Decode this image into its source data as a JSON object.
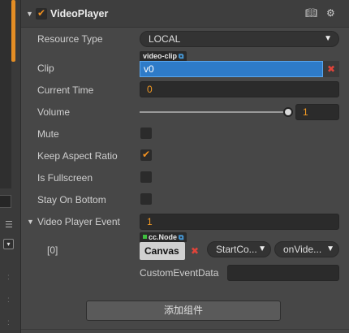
{
  "component": {
    "title": "VideoPlayer",
    "enabled": true,
    "header_icons": [
      "book-icon",
      "gear-icon"
    ]
  },
  "properties": {
    "resource_type": {
      "label": "Resource Type",
      "value": "LOCAL"
    },
    "clip": {
      "label": "Clip",
      "tag": "video-clip",
      "value": "v0"
    },
    "current_time": {
      "label": "Current Time",
      "value": "0"
    },
    "volume": {
      "label": "Volume",
      "value": "1",
      "fraction": 1
    },
    "mute": {
      "label": "Mute",
      "checked": false
    },
    "keep_aspect_ratio": {
      "label": "Keep Aspect Ratio",
      "checked": true
    },
    "is_fullscreen": {
      "label": "Is Fullscreen",
      "checked": false
    },
    "stay_on_bottom": {
      "label": "Stay On Bottom",
      "checked": false
    },
    "video_player_event": {
      "label": "Video Player Event",
      "count": "1",
      "entries": [
        {
          "index": "[0]",
          "node_tag": "cc.Node",
          "node": "Canvas",
          "component": "StartCo...",
          "handler": "onVide...",
          "custom_label": "CustomEventData",
          "custom_value": ""
        }
      ]
    }
  },
  "add_component_label": "添加组件",
  "colors": {
    "accent_orange": "#f39a24",
    "selection_blue": "#2e7bc8",
    "clear_red": "#e0443a",
    "panel_bg": "#474747"
  }
}
